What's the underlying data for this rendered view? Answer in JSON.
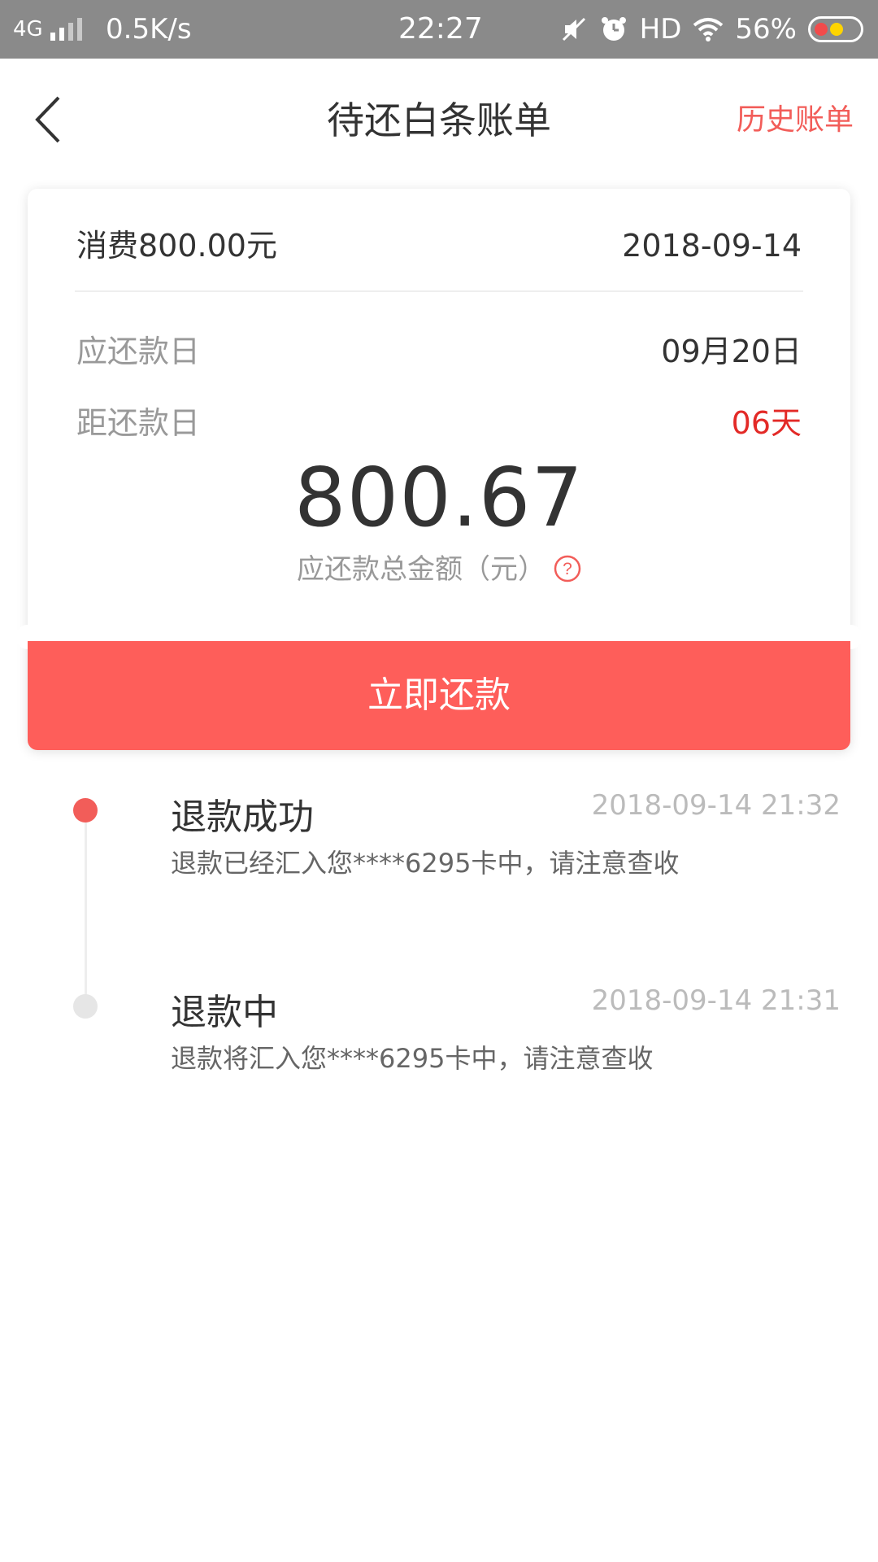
{
  "status_bar": {
    "network": "4G",
    "speed": "0.5K/s",
    "time": "22:27",
    "hd": "HD",
    "battery": "56%",
    "icons": [
      "signal-icon",
      "mute-icon",
      "alarm-icon",
      "wifi-icon",
      "battery-icon"
    ]
  },
  "nav": {
    "title": "待还白条账单",
    "history_label": "历史账单"
  },
  "bill": {
    "consumption": "消费800.00元",
    "date": "2018-09-14",
    "due_label": "应还款日",
    "due_value": "09月20日",
    "remaining_label": "距还款日",
    "remaining_value": "06天",
    "amount": "800.67",
    "amount_label": "应还款总金额（元）",
    "pay_button": "立即还款"
  },
  "timeline": [
    {
      "title": "退款成功",
      "time": "2018-09-14 21:32",
      "desc": "退款已经汇入您****6295卡中，请注意查收"
    },
    {
      "title": "退款中",
      "time": "2018-09-14 21:31",
      "desc": "退款将汇入您****6295卡中，请注意查收"
    }
  ],
  "colors": {
    "accent": "#fe5e5a",
    "red_text": "#e32a27",
    "status_bar": "#8a8a8a"
  }
}
